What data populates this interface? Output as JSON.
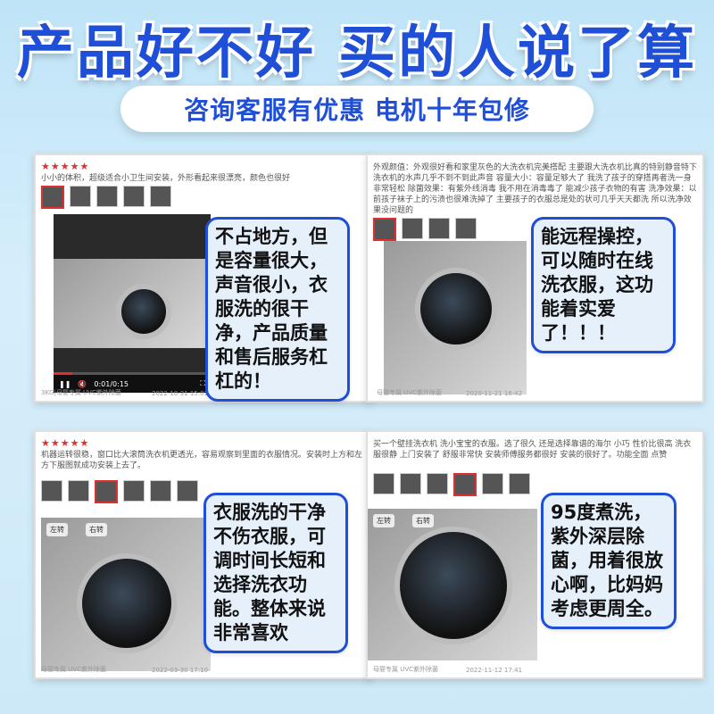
{
  "header": {
    "title": "产品好不好 买的人说了算",
    "subtitle": "咨询客服有优惠 电机十年包修"
  },
  "reviews": [
    {
      "stars": "★★★★★",
      "text": "小小的体积，超级适合小卫生间安装，外形看起来很漂亮，颜色也很好",
      "meta": "3KG|母婴专属 UVC紫外除菌",
      "date": "2022-10-31 15:01",
      "time": "0:01/0:15",
      "bubble": "不占地方，但是容量很大，声音很小，衣服洗的很干净，产品质量和售后服务杠杠的！"
    },
    {
      "stars": "",
      "text": "外观颜值：外观很好看和家里灰色的大洗衣机完美搭配 主要跟大洗衣机比真的特别静音特下洗衣机的水声几乎不到不到此声音 容量大小：容量足够大了 我洗了孩子的穿搭再者洗一身 非常轻松 除菌效果：有紫外线消毒 我不用在消毒毒了 能减少孩子衣物的有害 洗净效果：以前孩子袜子上的污渍也很难洗掉了 主要孩子的衣服总是处的状可几乎天天都洗 所以洗净效果没问题的",
      "meta": "母婴专属 UVC紫外除菌",
      "date": "2020-11-21 16:42",
      "bubble": "能远程操控，可以随时在线洗衣服，这功能着实爱了！！！"
    },
    {
      "stars": "★★★★★",
      "text": "机器运转很稳，窗口比大滚筒洗衣机更透光，容易观察到里面的衣服情况。安装时上方和左方下服图就成功安装上去了。",
      "meta": "母婴专属 UVC紫外除菌",
      "date": "2022-03-30 17:10",
      "rotate_left": "左转",
      "rotate_right": "右转",
      "bubble": "衣服洗的干净不伤衣服，可调时间长短和选择洗衣功能。整体来说非常喜欢"
    },
    {
      "stars": "",
      "text": "买一个壁挂洗衣机 洗小宝宝的衣服。选了很久 还是选择靠谱的海尔 小巧 性价比很高 洗衣服很静 上门安装了 舒服非常快 安装师傅服务都很好 安装的很好了。功能全面 点赞",
      "meta": "母婴专属 UVC紫外除菌",
      "date": "2022-11-12 17:41",
      "rotate_left": "左转",
      "rotate_right": "右转",
      "bubble": "95度煮洗，紫外深层除菌，用着很放心啊，比妈妈考虑更周全。"
    }
  ],
  "colors": {
    "accent": "#1f4fd6",
    "star": "#e02f2f",
    "bubble_bg": "#e6f0fb"
  }
}
